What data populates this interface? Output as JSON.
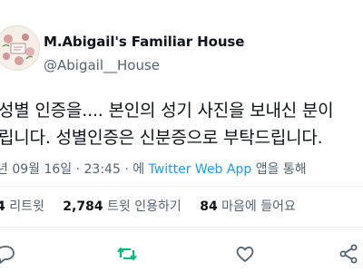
{
  "tweet": {
    "display_name": "M.Abigail's Familiar House",
    "handle": "@Abigail__House",
    "text_line1": "성별 인증을.... 본인의 성기 사진을 보내신 분이",
    "text_line2": "립니다. 성별인증은 신분증으로 부탁드립니다.",
    "meta_prefix": "년 09월 16일 · 23:45 · 에 ",
    "meta_via": "Twitter Web App",
    "meta_suffix": " 앱을 통해"
  },
  "stats": {
    "retweets_count": "4",
    "retweets_label": "리트윗",
    "quotes_count": "2,784",
    "quotes_label": "트윗 인용하기",
    "likes_count": "84",
    "likes_label": "마음에 들어요"
  },
  "icons": {
    "reply": "reply-icon",
    "retweet": "retweet-icon",
    "like": "heart-icon",
    "share": "share-icon"
  },
  "colors": {
    "retweet_green": "#00ba7c",
    "link_blue": "#1d9bf0",
    "muted_gray": "#536471"
  }
}
